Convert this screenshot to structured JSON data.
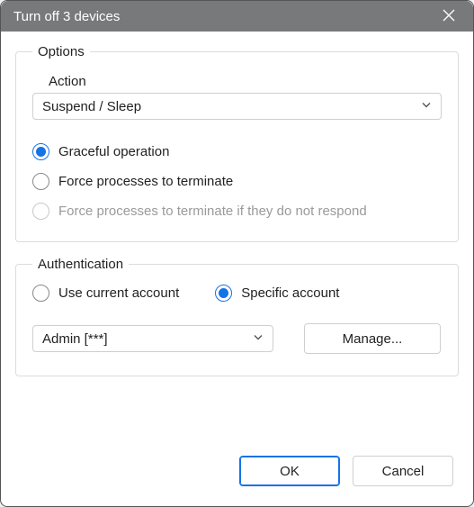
{
  "window": {
    "title": "Turn off 3 devices"
  },
  "options": {
    "legend": "Options",
    "action_label": "Action",
    "action_value": "Suspend / Sleep",
    "radios": {
      "graceful": "Graceful operation",
      "force": "Force processes to terminate",
      "force_nr": "Force processes to terminate if they do not respond"
    },
    "selected": "graceful",
    "disabled": [
      "force_nr"
    ]
  },
  "auth": {
    "legend": "Authentication",
    "current": "Use current account",
    "specific": "Specific account",
    "selected": "specific",
    "account_value": "Admin [***]",
    "manage_label": "Manage..."
  },
  "buttons": {
    "ok": "OK",
    "cancel": "Cancel"
  },
  "colors": {
    "accent": "#1473e6",
    "titlebar": "#77797b"
  }
}
